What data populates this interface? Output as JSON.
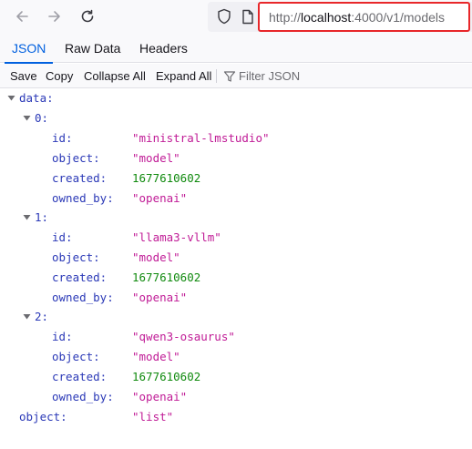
{
  "browser": {
    "url_prefix": "http://",
    "url_host": "localhost",
    "url_rest": ":4000/v1/models"
  },
  "tabs": [
    "JSON",
    "Raw Data",
    "Headers"
  ],
  "actions": {
    "save": "Save",
    "copy": "Copy",
    "collapse_all": "Collapse All",
    "expand_all": "Expand All",
    "filter_placeholder": "Filter JSON"
  },
  "json": {
    "data_key": "data:",
    "items": [
      {
        "index": "0:",
        "id_key": "id:",
        "id": "\"ministral-lmstudio\"",
        "object_key": "object:",
        "object": "\"model\"",
        "created_key": "created:",
        "created": "1677610602",
        "owned_by_key": "owned_by:",
        "owned_by": "\"openai\""
      },
      {
        "index": "1:",
        "id_key": "id:",
        "id": "\"llama3-vllm\"",
        "object_key": "object:",
        "object": "\"model\"",
        "created_key": "created:",
        "created": "1677610602",
        "owned_by_key": "owned_by:",
        "owned_by": "\"openai\""
      },
      {
        "index": "2:",
        "id_key": "id:",
        "id": "\"qwen3-osaurus\"",
        "object_key": "object:",
        "object": "\"model\"",
        "created_key": "created:",
        "created": "1677610602",
        "owned_by_key": "owned_by:",
        "owned_by": "\"openai\""
      }
    ],
    "object_key": "object:",
    "object_value": "\"list\""
  },
  "colors": {
    "highlight_border": "#e8272a",
    "active_tab": "#0060df",
    "json_key": "#2b39b7",
    "json_string": "#c01b96",
    "json_number": "#108a0e"
  },
  "icons": [
    "back-arrow-icon",
    "forward-arrow-icon",
    "reload-icon",
    "shield-icon",
    "page-icon",
    "filter-icon",
    "twisty-down-icon"
  ]
}
